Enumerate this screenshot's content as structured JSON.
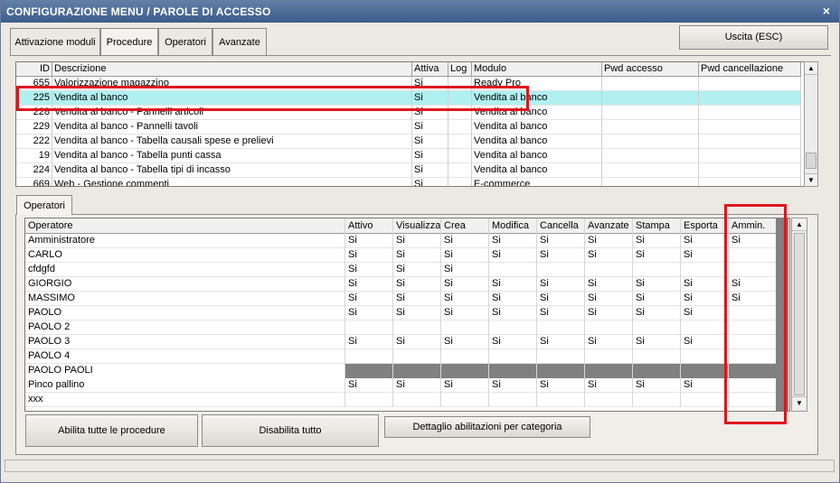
{
  "window": {
    "title": "CONFIGURAZIONE MENU / PAROLE DI ACCESSO",
    "close_symbol": "×"
  },
  "tabs": [
    {
      "label": "Attivazione moduli"
    },
    {
      "label": "Procedure"
    },
    {
      "label": "Operatori"
    },
    {
      "label": "Avanzate"
    }
  ],
  "exit_button": "Uscita (ESC)",
  "procedures": {
    "columns": [
      "ID",
      "Descrizione",
      "Attiva",
      "Log",
      "Modulo",
      "Pwd accesso",
      "Pwd cancellazione"
    ],
    "rows": [
      {
        "id": "655",
        "desc": "Valorizzazione magazzino",
        "attiva": "Si",
        "log": "",
        "modulo": "Ready Pro"
      },
      {
        "id": "225",
        "desc": "Vendita al banco",
        "attiva": "Si",
        "log": "",
        "modulo": "Vendita al banco",
        "selected": true
      },
      {
        "id": "228",
        "desc": "Vendita al banco - Pannelli articoli",
        "attiva": "Si",
        "log": "",
        "modulo": "Vendita al banco"
      },
      {
        "id": "229",
        "desc": "Vendita al banco - Pannelli tavoli",
        "attiva": "Si",
        "log": "",
        "modulo": "Vendita al banco"
      },
      {
        "id": "222",
        "desc": "Vendita al banco - Tabella causali spese e prelievi",
        "attiva": "Si",
        "log": "",
        "modulo": "Vendita al banco"
      },
      {
        "id": "19",
        "desc": "Vendita al banco - Tabella punti cassa",
        "attiva": "Si",
        "log": "",
        "modulo": "Vendita al banco"
      },
      {
        "id": "224",
        "desc": "Vendita al banco - Tabella tipi di incasso",
        "attiva": "Si",
        "log": "",
        "modulo": "Vendita al banco"
      },
      {
        "id": "669",
        "desc": "Web - Gestione commenti",
        "attiva": "Si",
        "log": "",
        "modulo": "E-commerce"
      }
    ]
  },
  "operators_tab": "Operatori",
  "operators": {
    "columns": [
      "Operatore",
      "Attivo",
      "Visualizza",
      "Crea",
      "Modifica",
      "Cancella",
      "Avanzate",
      "Stampa",
      "Esporta",
      "Ammin."
    ],
    "rows": [
      {
        "name": "Amministratore",
        "vals": [
          "Si",
          "Si",
          "Si",
          "Si",
          "Si",
          "Si",
          "Si",
          "Si",
          "Si"
        ]
      },
      {
        "name": "CARLO",
        "vals": [
          "Si",
          "Si",
          "Si",
          "Si",
          "Si",
          "Si",
          "Si",
          "Si",
          ""
        ]
      },
      {
        "name": "cfdgfd",
        "vals": [
          "Si",
          "Si",
          "Si",
          "",
          "",
          "",
          "",
          "",
          ""
        ]
      },
      {
        "name": "GIORGIO",
        "vals": [
          "Si",
          "Si",
          "Si",
          "Si",
          "Si",
          "Si",
          "Si",
          "Si",
          "Si"
        ]
      },
      {
        "name": "MASSIMO",
        "vals": [
          "Si",
          "Si",
          "Si",
          "Si",
          "Si",
          "Si",
          "Si",
          "Si",
          "Si"
        ]
      },
      {
        "name": "PAOLO",
        "vals": [
          "Si",
          "Si",
          "Si",
          "Si",
          "Si",
          "Si",
          "Si",
          "Si",
          ""
        ]
      },
      {
        "name": "PAOLO 2",
        "vals": [
          "",
          "",
          "",
          "",
          "",
          "",
          "",
          "",
          ""
        ]
      },
      {
        "name": "PAOLO 3",
        "vals": [
          "Si",
          "Si",
          "Si",
          "Si",
          "Si",
          "Si",
          "Si",
          "Si",
          ""
        ]
      },
      {
        "name": "PAOLO 4",
        "vals": [
          "",
          "",
          "",
          "",
          "",
          "",
          "",
          "",
          ""
        ]
      },
      {
        "name": "PAOLO PAOLI",
        "vals": [
          "",
          "",
          "",
          "",
          "",
          "",
          "",
          "",
          ""
        ],
        "dark": true
      },
      {
        "name": "Pinco pallino",
        "vals": [
          "Si",
          "Si",
          "Si",
          "Si",
          "Si",
          "Si",
          "Si",
          "Si",
          ""
        ]
      },
      {
        "name": "xxx",
        "vals": [
          "",
          "",
          "",
          "",
          "",
          "",
          "",
          "",
          ""
        ]
      }
    ]
  },
  "buttons": {
    "enable_all": "Abilita tutte le procedure",
    "disable_all": "Disabilita tutto",
    "detail": "Dettaglio abilitazioni per categoria"
  },
  "colors": {
    "selection": "#b0f0f0",
    "highlight": "#e0141e",
    "disabled_row": "#808080"
  }
}
